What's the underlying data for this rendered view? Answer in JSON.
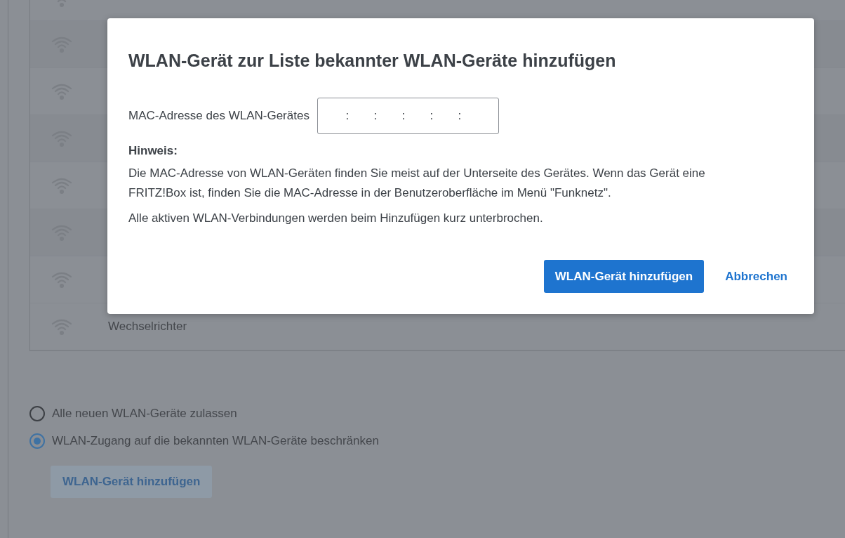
{
  "devices": [
    {
      "name": "Wechselrichter"
    }
  ],
  "access_options": [
    {
      "label": "Alle neuen WLAN-Geräte zulassen",
      "selected": false
    },
    {
      "label": "WLAN-Zugang auf die bekannten WLAN-Geräte beschränken",
      "selected": true
    }
  ],
  "add_button": "WLAN-Gerät hinzufügen",
  "dialog": {
    "title": "WLAN-Gerät zur Liste bekannter WLAN-Geräte hinzufügen",
    "mac_label": "MAC-Adresse des WLAN-Gerätes",
    "mac_separators": [
      ":",
      ":",
      ":",
      ":",
      ":"
    ],
    "hint_heading": "Hinweis:",
    "hint_paragraphs": [
      "Die MAC-Adresse von WLAN-Geräten finden Sie meist auf der Unterseite des Gerätes. Wenn das Gerät eine FRITZ!Box ist, finden Sie die MAC-Adresse in der Benutzeroberfläche im Menü \"Funknetz\".",
      "Alle aktiven WLAN-Verbindungen werden beim Hinzufügen kurz unterbrochen."
    ],
    "confirm": "WLAN-Gerät hinzufügen",
    "cancel": "Abbrechen"
  }
}
